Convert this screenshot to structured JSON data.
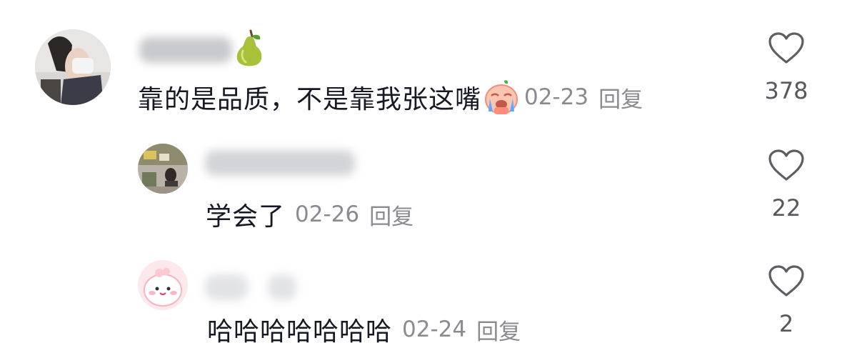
{
  "comments": [
    {
      "text": "靠的是品质，不是靠我张这嘴",
      "date": "02-23",
      "reply_label": "回复",
      "likes": "378",
      "name_emoji": "pear-emoji",
      "inline_emoji": "crying-face-emoji"
    },
    {
      "text": "学会了",
      "date": "02-26",
      "reply_label": "回复",
      "likes": "22"
    },
    {
      "text": "哈哈哈哈哈哈哈",
      "date": "02-24",
      "reply_label": "回复",
      "likes": "2"
    }
  ],
  "icons": {
    "like": "heart-outline-icon"
  },
  "colors": {
    "text": "#161823",
    "meta": "#8a8b91",
    "count": "#57585d"
  }
}
